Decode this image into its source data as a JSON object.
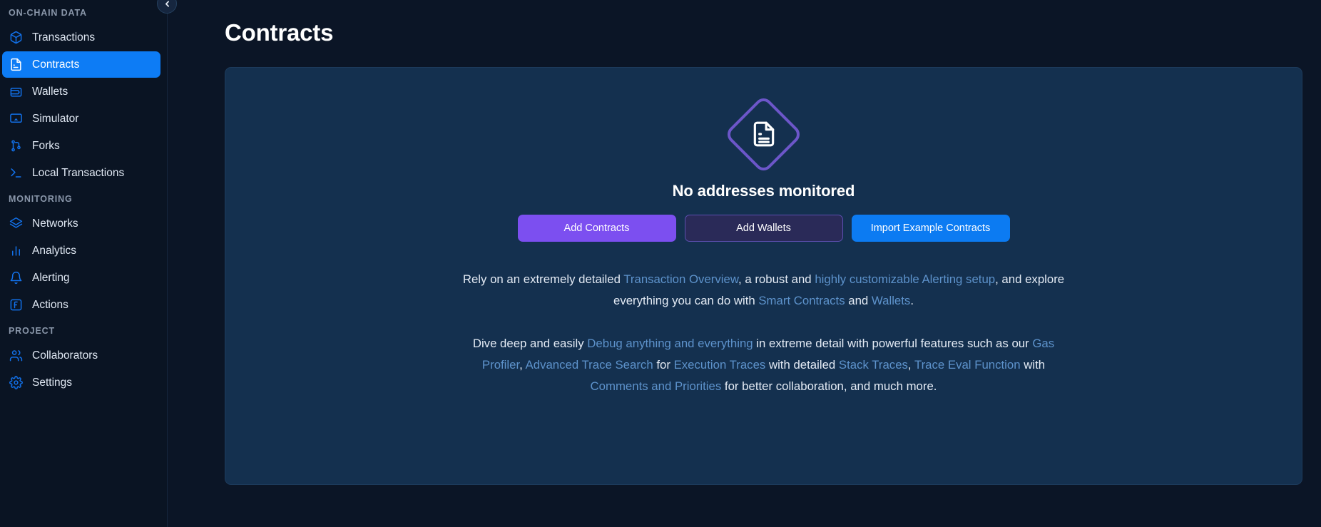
{
  "sidebar": {
    "collapse_icon": "chevron-left-icon",
    "sections": [
      {
        "label": "ON-CHAIN DATA",
        "items": [
          {
            "label": "Transactions",
            "icon": "cube-icon",
            "active": false
          },
          {
            "label": "Contracts",
            "icon": "document-icon",
            "active": true
          },
          {
            "label": "Wallets",
            "icon": "wallet-icon",
            "active": false
          },
          {
            "label": "Simulator",
            "icon": "monitor-icon",
            "active": false
          },
          {
            "label": "Forks",
            "icon": "fork-icon",
            "active": false
          },
          {
            "label": "Local Transactions",
            "icon": "terminal-icon",
            "active": false
          }
        ]
      },
      {
        "label": "MONITORING",
        "items": [
          {
            "label": "Networks",
            "icon": "layers-icon",
            "active": false
          },
          {
            "label": "Analytics",
            "icon": "bar-chart-icon",
            "active": false
          },
          {
            "label": "Alerting",
            "icon": "bell-icon",
            "active": false
          },
          {
            "label": "Actions",
            "icon": "action-f-icon",
            "active": false
          }
        ]
      },
      {
        "label": "PROJECT",
        "items": [
          {
            "label": "Collaborators",
            "icon": "users-icon",
            "active": false
          },
          {
            "label": "Settings",
            "icon": "gear-icon",
            "active": false
          }
        ]
      }
    ]
  },
  "main": {
    "page_title": "Contracts",
    "empty_state": {
      "badge_icon": "document-icon",
      "title": "No addresses monitored",
      "buttons": [
        {
          "label": "Add Contracts",
          "style": "primary"
        },
        {
          "label": "Add Wallets",
          "style": "outline"
        },
        {
          "label": "Import Example Contracts",
          "style": "blue"
        }
      ],
      "paragraph_1": [
        {
          "text": "Rely on an extremely detailed ",
          "link": false
        },
        {
          "text": "Transaction Overview",
          "link": true
        },
        {
          "text": ", a robust and ",
          "link": false
        },
        {
          "text": "highly customizable Alerting setup",
          "link": true
        },
        {
          "text": ", and explore everything you can do with ",
          "link": false
        },
        {
          "text": "Smart Contracts",
          "link": true
        },
        {
          "text": " and ",
          "link": false
        },
        {
          "text": "Wallets",
          "link": true
        },
        {
          "text": ".",
          "link": false
        }
      ],
      "paragraph_2": [
        {
          "text": "Dive deep and easily ",
          "link": false
        },
        {
          "text": "Debug anything and everything",
          "link": true
        },
        {
          "text": " in extreme detail with powerful features such as our ",
          "link": false
        },
        {
          "text": "Gas Profiler",
          "link": true
        },
        {
          "text": ", ",
          "link": false
        },
        {
          "text": "Advanced Trace Search",
          "link": true
        },
        {
          "text": " for ",
          "link": false
        },
        {
          "text": "Execution Traces",
          "link": true
        },
        {
          "text": " with detailed ",
          "link": false
        },
        {
          "text": "Stack Traces",
          "link": true
        },
        {
          "text": ", ",
          "link": false
        },
        {
          "text": "Trace Eval Function",
          "link": true
        },
        {
          "text": " with ",
          "link": false
        },
        {
          "text": "Comments and Priorities",
          "link": true
        },
        {
          "text": " for better collaboration, and much more.",
          "link": false
        }
      ]
    }
  },
  "colors": {
    "page_bg": "#0b1526",
    "sidebar_bg": "#0a1423",
    "panel_bg": "#14304f",
    "active_nav": "#0d7cf5",
    "icon_blue": "#1271ea",
    "btn_purple": "#7c4ff0",
    "btn_blue": "#0c7bf2",
    "link_blue": "#5d92cb",
    "badge_purple": "#6c56c9"
  }
}
